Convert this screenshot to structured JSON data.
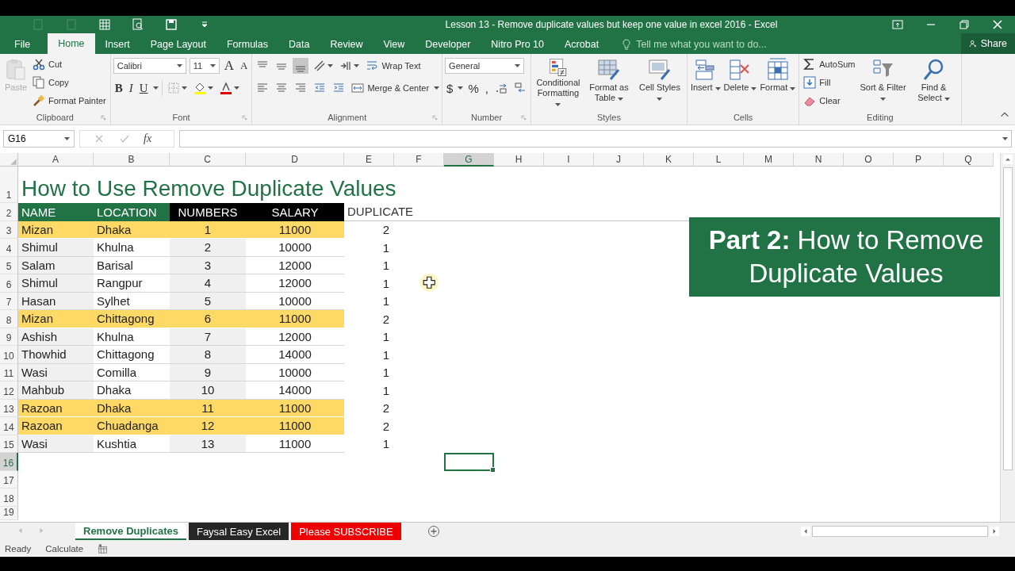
{
  "window": {
    "title": "Lesson 13 - Remove duplicate values but keep one value in excel 2016 - Excel"
  },
  "menu_tabs": [
    {
      "label": "File",
      "selected": false
    },
    {
      "label": "Home",
      "selected": true
    },
    {
      "label": "Insert",
      "selected": false
    },
    {
      "label": "Page Layout",
      "selected": false
    },
    {
      "label": "Formulas",
      "selected": false
    },
    {
      "label": "Data",
      "selected": false
    },
    {
      "label": "Review",
      "selected": false
    },
    {
      "label": "View",
      "selected": false
    },
    {
      "label": "Developer",
      "selected": false
    },
    {
      "label": "Nitro Pro 10",
      "selected": false
    },
    {
      "label": "Acrobat",
      "selected": false
    }
  ],
  "tell_me": {
    "placeholder": "Tell me what you want to do..."
  },
  "share": "Share",
  "ribbon": {
    "groups": [
      {
        "name": "Clipboard",
        "items": [
          {
            "kind": "large",
            "label": "Paste",
            "disabled": true
          },
          {
            "kind": "small",
            "label": "Cut",
            "disabled": false
          },
          {
            "kind": "small",
            "label": "Copy",
            "disabled": false
          },
          {
            "kind": "small",
            "label": "Format Painter",
            "disabled": false
          }
        ]
      },
      {
        "name": "Font",
        "items": [
          {
            "kind": "combo",
            "value": "Calibri"
          },
          {
            "kind": "combo",
            "value": "11"
          },
          {
            "kind": "glyph",
            "label": "A"
          },
          {
            "kind": "glyph",
            "label": "A"
          },
          {
            "kind": "glyph",
            "label": "B"
          },
          {
            "kind": "glyph",
            "label": "I"
          },
          {
            "kind": "glyph",
            "label": "U"
          }
        ]
      },
      {
        "name": "Alignment",
        "items": [
          {
            "kind": "small",
            "label": "Wrap Text"
          },
          {
            "kind": "small",
            "label": "Merge & Center"
          }
        ]
      },
      {
        "name": "Number",
        "items": [
          {
            "kind": "combo",
            "value": "General"
          },
          {
            "kind": "glyph",
            "label": "$"
          },
          {
            "kind": "glyph",
            "label": "%"
          },
          {
            "kind": "glyph",
            "label": ","
          }
        ]
      },
      {
        "name": "Styles",
        "items": [
          {
            "kind": "large",
            "label": "Conditional Formatting"
          },
          {
            "kind": "large",
            "label": "Format as Table"
          },
          {
            "kind": "large",
            "label": "Cell Styles"
          }
        ]
      },
      {
        "name": "Cells",
        "items": [
          {
            "kind": "large",
            "label": "Insert"
          },
          {
            "kind": "large",
            "label": "Delete"
          },
          {
            "kind": "large",
            "label": "Format"
          }
        ]
      },
      {
        "name": "Editing",
        "items": [
          {
            "kind": "small",
            "label": "AutoSum"
          },
          {
            "kind": "small",
            "label": "Fill"
          },
          {
            "kind": "small",
            "label": "Clear"
          },
          {
            "kind": "large",
            "label": "Sort & Filter"
          },
          {
            "kind": "large",
            "label": "Find & Select"
          }
        ]
      }
    ]
  },
  "formula_bar": {
    "name_box": "G16",
    "function_label": "fx"
  },
  "sheet": {
    "columns": [
      {
        "label": "A",
        "selected": false
      },
      {
        "label": "B",
        "selected": false
      },
      {
        "label": "C",
        "selected": false
      },
      {
        "label": "D",
        "selected": false
      },
      {
        "label": "E",
        "selected": false
      },
      {
        "label": "F",
        "selected": false
      },
      {
        "label": "G",
        "selected": true
      },
      {
        "label": "H",
        "selected": false
      },
      {
        "label": "I",
        "selected": false
      },
      {
        "label": "J",
        "selected": false
      },
      {
        "label": "K",
        "selected": false
      },
      {
        "label": "L",
        "selected": false
      },
      {
        "label": "M",
        "selected": false
      },
      {
        "label": "N",
        "selected": false
      },
      {
        "label": "O",
        "selected": false
      },
      {
        "label": "P",
        "selected": false
      },
      {
        "label": "Q",
        "selected": false
      }
    ],
    "rows": [
      {
        "label": "1",
        "selected": false
      },
      {
        "label": "2",
        "selected": false
      },
      {
        "label": "3",
        "selected": false
      },
      {
        "label": "4",
        "selected": false
      },
      {
        "label": "5",
        "selected": false
      },
      {
        "label": "6",
        "selected": false
      },
      {
        "label": "7",
        "selected": false
      },
      {
        "label": "8",
        "selected": false
      },
      {
        "label": "9",
        "selected": false
      },
      {
        "label": "10",
        "selected": false
      },
      {
        "label": "11",
        "selected": false
      },
      {
        "label": "12",
        "selected": false
      },
      {
        "label": "13",
        "selected": false
      },
      {
        "label": "14",
        "selected": false
      },
      {
        "label": "15",
        "selected": false
      },
      {
        "label": "16",
        "selected": true
      },
      {
        "label": "17",
        "selected": false
      },
      {
        "label": "18",
        "selected": false
      },
      {
        "label": "19",
        "selected": false
      }
    ],
    "title": "How to Use Remove Duplicate Values",
    "headers": [
      {
        "text": "NAME",
        "color": "#217346"
      },
      {
        "text": "LOCATION",
        "color": "#217346"
      },
      {
        "text": "NUMBERS",
        "color": "#000000"
      },
      {
        "text": "SALARY",
        "color": "#000000"
      },
      {
        "text": "DUPLICATE",
        "color": "#ffffff"
      }
    ],
    "records": [
      {
        "highlighted": true,
        "cells": [
          "Mizan",
          "Dhaka",
          "1",
          "11000",
          "2"
        ]
      },
      {
        "highlighted": false,
        "cells": [
          "Shimul",
          "Khulna",
          "2",
          "10000",
          "1"
        ]
      },
      {
        "highlighted": false,
        "cells": [
          "Salam",
          "Barisal",
          "3",
          "12000",
          "1"
        ]
      },
      {
        "highlighted": false,
        "cells": [
          "Shimul",
          "Rangpur",
          "4",
          "12000",
          "1"
        ]
      },
      {
        "highlighted": false,
        "cells": [
          "Hasan",
          "Sylhet",
          "5",
          "10000",
          "1"
        ]
      },
      {
        "highlighted": true,
        "cells": [
          "Mizan",
          "Chittagong",
          "6",
          "11000",
          "2"
        ]
      },
      {
        "highlighted": false,
        "cells": [
          "Ashish",
          "Khulna",
          "7",
          "12000",
          "1"
        ]
      },
      {
        "highlighted": false,
        "cells": [
          "Thowhid",
          "Chittagong",
          "8",
          "14000",
          "1"
        ]
      },
      {
        "highlighted": false,
        "cells": [
          "Wasi",
          "Comilla",
          "9",
          "10000",
          "1"
        ]
      },
      {
        "highlighted": false,
        "cells": [
          "Mahbub",
          "Dhaka",
          "10",
          "14000",
          "1"
        ]
      },
      {
        "highlighted": true,
        "cells": [
          "Razoan",
          "Dhaka",
          "11",
          "11000",
          "2"
        ]
      },
      {
        "highlighted": true,
        "cells": [
          "Razoan",
          "Chuadanga",
          "12",
          "11000",
          "2"
        ]
      },
      {
        "highlighted": false,
        "cells": [
          "Wasi",
          "Kushtia",
          "13",
          "11000",
          "1"
        ]
      }
    ]
  },
  "banner": {
    "text": "**Part 2:** How to Remove Duplicate Values"
  },
  "sheet_tabs": [
    {
      "label": "Remove Duplicates",
      "selected": true,
      "color": "#ffffff"
    },
    {
      "label": "Faysal Easy Excel",
      "selected": false,
      "color": "#262626"
    },
    {
      "label": "Please SUBSCRIBE",
      "selected": false,
      "color": "#ee0000"
    }
  ],
  "status_bar": {
    "items": [
      "Ready",
      "Calculate"
    ]
  }
}
